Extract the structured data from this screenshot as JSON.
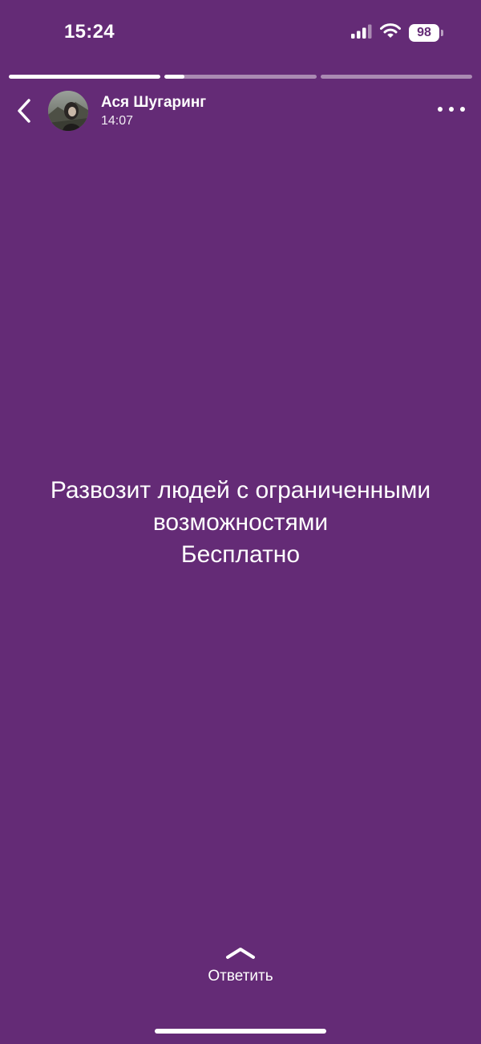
{
  "status_bar": {
    "time": "15:24",
    "battery": "98",
    "icons": [
      "cellular-signal-icon",
      "wifi-icon",
      "battery-icon"
    ]
  },
  "story_progress": [
    1,
    0.13,
    0
  ],
  "header": {
    "author": "Ася Шугаринг",
    "time": "14:07"
  },
  "story": {
    "lines": [
      "Развозит людей с ограниченными",
      "возможностями",
      "Бесплатно"
    ],
    "background_color": "#642b76"
  },
  "reply": {
    "label": "Ответить"
  }
}
